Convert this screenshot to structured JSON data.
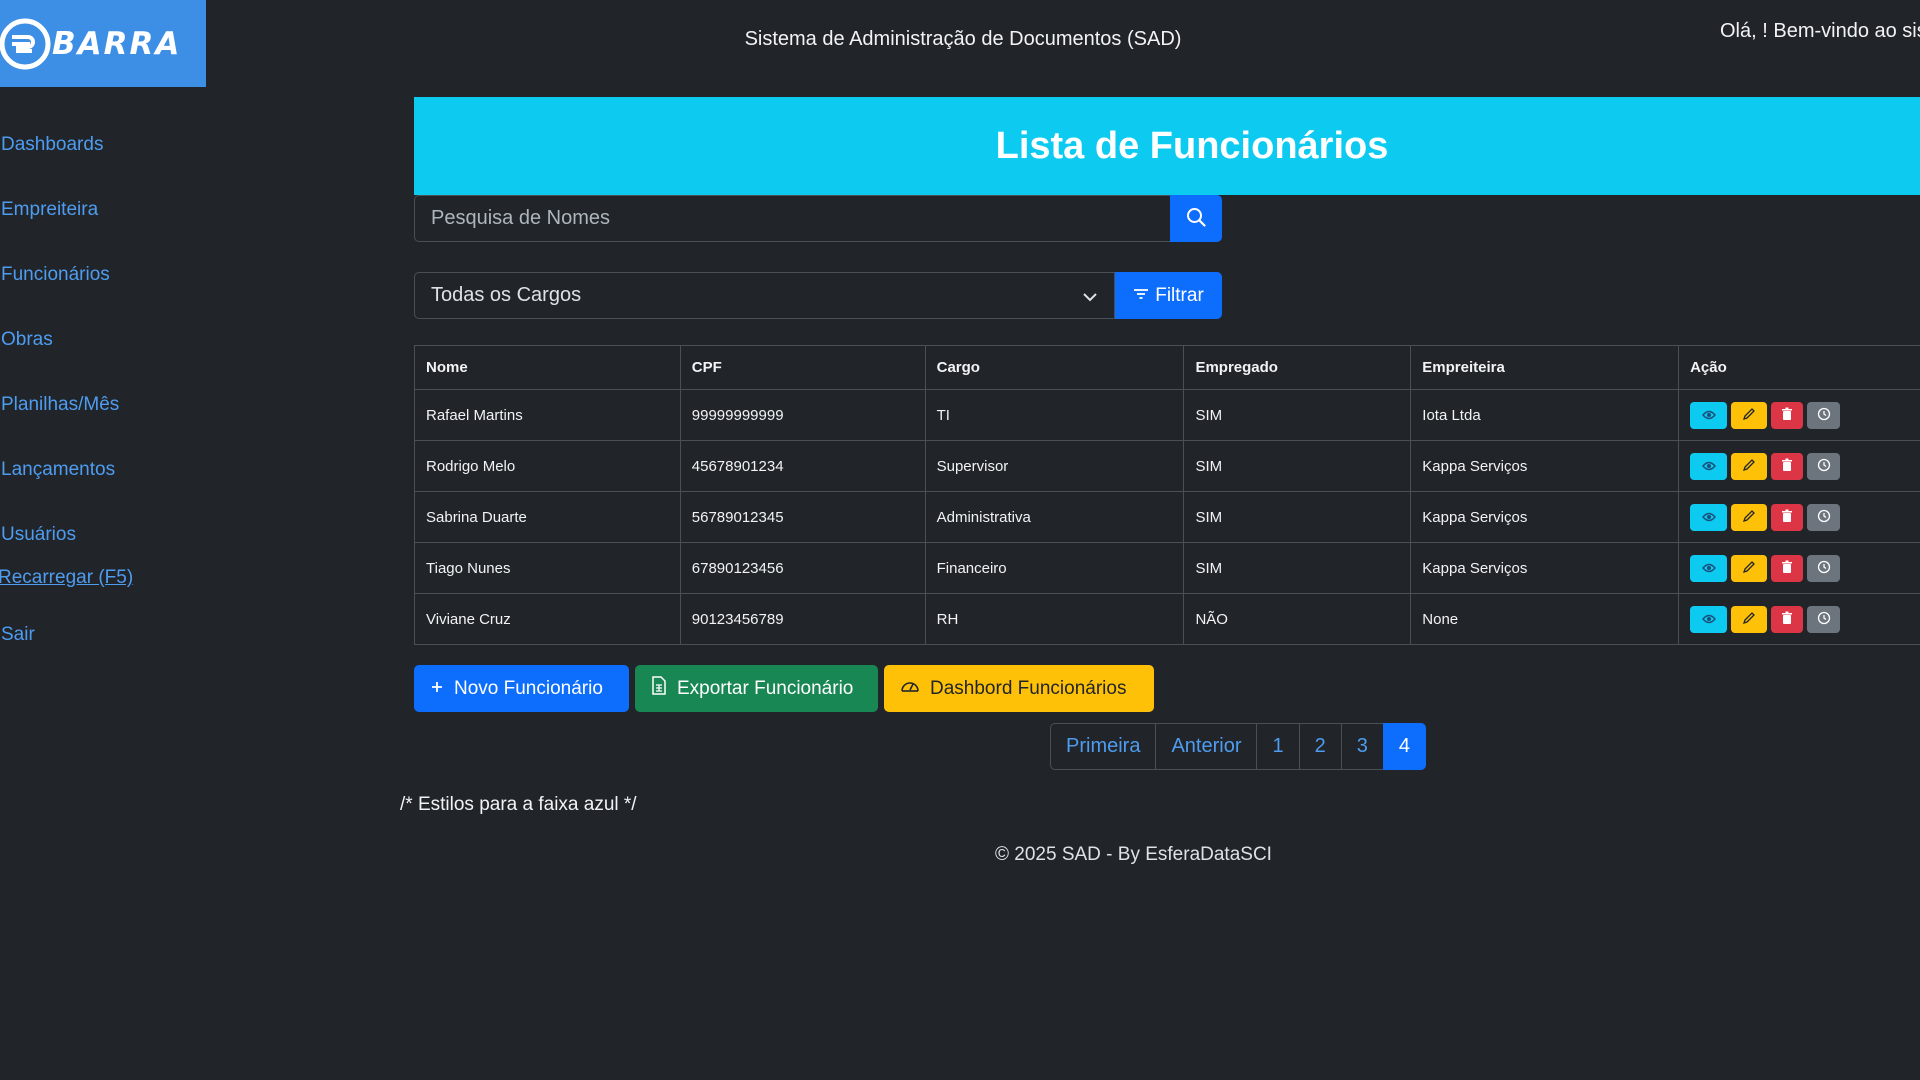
{
  "logo": {
    "text": "BARRA"
  },
  "header": {
    "title": "Sistema de Administração de Documentos (SAD)",
    "welcome": "Olá, ! Bem-vindo ao sis"
  },
  "sidebar": {
    "items": [
      {
        "label": "Dashboards"
      },
      {
        "label": "Empreiteira"
      },
      {
        "label": "Funcionários"
      },
      {
        "label": "Obras"
      },
      {
        "label": "Planilhas/Mês"
      },
      {
        "label": "Lançamentos"
      },
      {
        "label": "Usuários"
      },
      {
        "label": "Recarregar (F5) "
      },
      {
        "label": "Sair"
      }
    ]
  },
  "main": {
    "banner_title": "Lista de Funcionários",
    "search": {
      "placeholder": "Pesquisa de Nomes",
      "value": ""
    },
    "filter": {
      "selected": "Todas os Cargos",
      "button_label": "Filtrar"
    },
    "table": {
      "headers": [
        "Nome",
        "CPF",
        "Cargo",
        "Empregado",
        "Empreiteira",
        "Ação"
      ],
      "rows": [
        {
          "nome": "Rafael Martins",
          "cpf": "99999999999",
          "cargo": "TI",
          "empregado": "SIM",
          "empreiteira": "Iota Ltda"
        },
        {
          "nome": "Rodrigo Melo",
          "cpf": "45678901234",
          "cargo": "Supervisor",
          "empregado": "SIM",
          "empreiteira": "Kappa Serviços"
        },
        {
          "nome": "Sabrina Duarte",
          "cpf": "56789012345",
          "cargo": "Administrativa",
          "empregado": "SIM",
          "empreiteira": "Kappa Serviços"
        },
        {
          "nome": "Tiago Nunes",
          "cpf": "67890123456",
          "cargo": "Financeiro",
          "empregado": "SIM",
          "empreiteira": "Kappa Serviços"
        },
        {
          "nome": "Viviane Cruz",
          "cpf": "90123456789",
          "cargo": "RH",
          "empregado": "NÃO",
          "empreiteira": "None"
        }
      ]
    },
    "buttons": {
      "new": "Novo Funcionário",
      "export": "Exportar Funcionário",
      "dashboard": "Dashbord Funcionários"
    },
    "pagination": {
      "first": "Primeira",
      "prev": "Anterior",
      "pages": [
        "1",
        "2",
        "3",
        "4"
      ],
      "active_page": "4"
    },
    "css_comment": "/* Estilos para a faixa azul */",
    "footer": "© 2025 SAD - By EsferaDataSCI"
  },
  "colors": {
    "background": "#212529",
    "primary": "#0d6efd",
    "info": "#0dcaf0",
    "warning": "#ffc107",
    "danger": "#dc3545",
    "success": "#198754",
    "secondary": "#6c757d",
    "link": "#4e9cf0"
  },
  "icons": [
    "search-icon",
    "filter-icon",
    "chevron-down-icon",
    "eye-icon",
    "pencil-icon",
    "trash-icon",
    "clock-icon",
    "plus-icon",
    "file-excel-icon",
    "speedometer-icon"
  ]
}
